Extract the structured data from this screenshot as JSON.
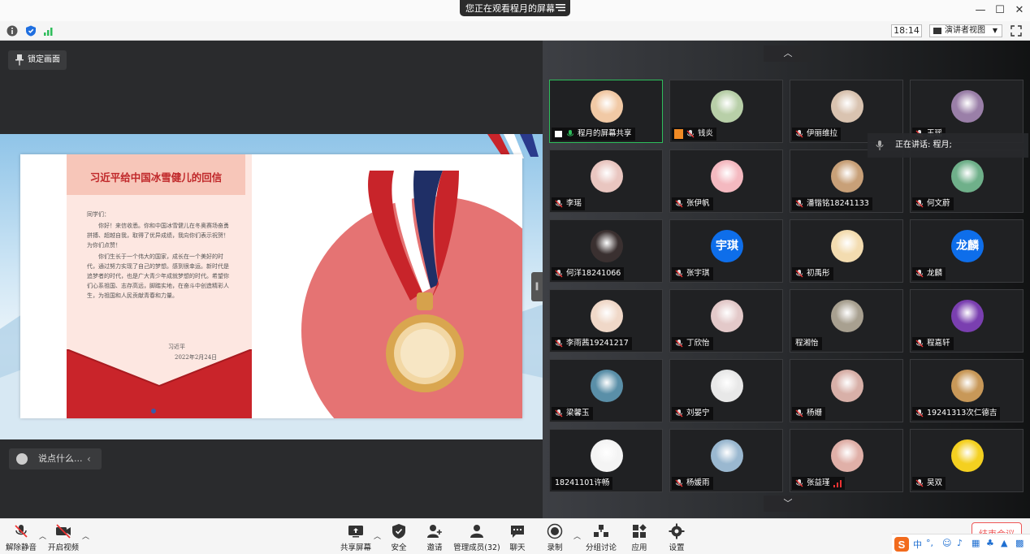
{
  "titlebar": {
    "share_notice": "您正在观看程月的屏幕"
  },
  "infobar": {
    "time": "18:14",
    "view_mode": "演讲者视图"
  },
  "stage": {
    "lock_label": "锁定画面",
    "chat_placeholder": "说点什么..."
  },
  "slide": {
    "title": "习近平给中国冰雪健儿的回信",
    "greeting": "同学们：",
    "paragraphs": [
      "你好！来信收悉。你和中国冰雪健儿在冬奥赛场奋勇拼搏、超越自我，取得了优异成绩，我向你们表示祝贺！为你们点赞！",
      "你们生长于一个伟大的国家，成长在一个美好的时代，通过努力实现了自己的梦想。感到很幸运。新时代是追梦者的时代，也是广大青少年成就梦想的时代。希望你们心系祖国、志存高远，脚踏实地，在奋斗中创造精彩人生，为祖国和人民贡献青春和力量。"
    ],
    "signature": "习近平",
    "date": "2022年2月24日"
  },
  "speaking": {
    "text": "正在讲话: 程月;"
  },
  "gallery": {
    "tiles": [
      {
        "name": "程月的屏幕共享",
        "avatar": "photo",
        "color": "#f1c9a5",
        "share": true
      },
      {
        "name": "钱炎",
        "avatar": "photo",
        "color": "#b8cfa8",
        "cam": true
      },
      {
        "name": "伊丽维拉",
        "avatar": "photo",
        "color": "#d9c3b0"
      },
      {
        "name": "王瑶",
        "avatar": "photo",
        "color": "#9a7fa8"
      },
      {
        "name": "李瑶",
        "avatar": "photo",
        "color": "#e9c6c0"
      },
      {
        "name": "张伊帆",
        "avatar": "photo",
        "color": "#f4b9c0"
      },
      {
        "name": "潘锴铭18241133",
        "avatar": "photo",
        "color": "#c8a078"
      },
      {
        "name": "何文蔚",
        "avatar": "photo",
        "color": "#6fb08a"
      },
      {
        "name": "何洋18241066",
        "avatar": "photo",
        "color": "#3a3030"
      },
      {
        "name": "张宇琪",
        "avatar": "text",
        "avatar_text": "宇琪"
      },
      {
        "name": "初禹彤",
        "avatar": "photo",
        "color": "#f3dcb0"
      },
      {
        "name": "龙麟",
        "avatar": "text",
        "avatar_text": "龙麟"
      },
      {
        "name": "李雨茜19241217",
        "avatar": "photo",
        "color": "#f0d8c8"
      },
      {
        "name": "丁欣怡",
        "avatar": "photo",
        "color": "#e3c9c9"
      },
      {
        "name": "程湘怡",
        "avatar": "photo",
        "color": "#a8a090",
        "plain": true
      },
      {
        "name": "程嘉轩",
        "avatar": "photo",
        "color": "#7a3fb0"
      },
      {
        "name": "梁馨玉",
        "avatar": "photo",
        "color": "#5a8fa8"
      },
      {
        "name": "刘晏宁",
        "avatar": "photo",
        "color": "#e8e8e8"
      },
      {
        "name": "杨姗",
        "avatar": "photo",
        "color": "#d8b0a8"
      },
      {
        "name": "19241313次仁德吉",
        "avatar": "photo",
        "color": "#c89858"
      },
      {
        "name": "18241101许畅",
        "avatar": "photo",
        "color": "#f4f4f4",
        "plain": true
      },
      {
        "name": "杨媛雨",
        "avatar": "photo",
        "color": "#9ab8d0"
      },
      {
        "name": "张益瑾",
        "avatar": "photo",
        "color": "#e0b0a8",
        "bars": true
      },
      {
        "name": "吴双",
        "avatar": "photo",
        "color": "#f4d020"
      }
    ]
  },
  "toolbar": {
    "unmute": "解除静音",
    "start_video": "开启视频",
    "share_screen": "共享屏幕",
    "security": "安全",
    "invite": "邀请",
    "participants": "管理成员(32)",
    "chat": "聊天",
    "record": "录制",
    "breakout": "分组讨论",
    "apps": "应用",
    "settings": "设置",
    "end_meeting": "结束会议"
  },
  "ime": {
    "mode": "中"
  },
  "colors": {
    "active_border": "#2ebd5b",
    "avatar_blue": "#0e6eea",
    "end_red": "#e55555",
    "title_red": "#c0282a"
  }
}
